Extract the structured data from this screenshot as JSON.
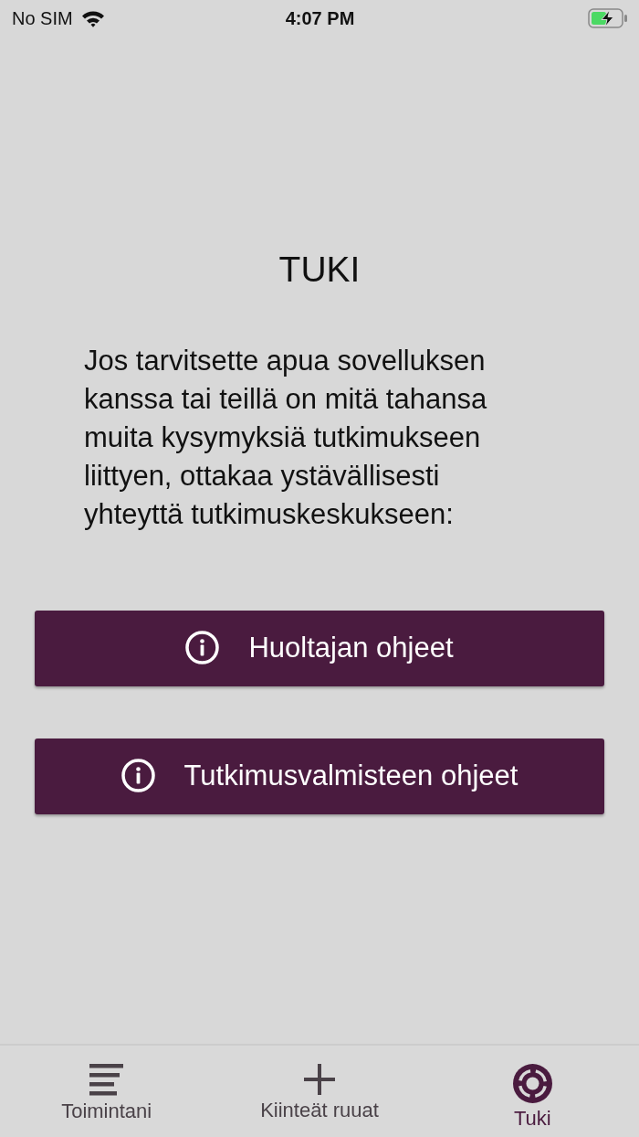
{
  "status_bar": {
    "carrier": "No SIM",
    "time": "4:07 PM",
    "charging": true
  },
  "page": {
    "title": "TUKI",
    "body_lines": [
      "Jos tarvitsette apua sovelluksen",
      "kanssa tai teillä on mitä tahansa",
      "muita kysymyksiä tutkimukseen",
      "liittyen, ottakaa ystävällisesti",
      "yhteyttä tutkimuskeskukseen:"
    ]
  },
  "buttons": [
    {
      "label": "Huoltajan ohjeet"
    },
    {
      "label": "Tutkimusvalmisteen ohjeet"
    }
  ],
  "tab_bar": {
    "tabs": [
      {
        "label": "Toimintani",
        "selected": false
      },
      {
        "label": "Kiinteät ruuat",
        "selected": false
      },
      {
        "label": "Tuki",
        "selected": true
      }
    ]
  }
}
